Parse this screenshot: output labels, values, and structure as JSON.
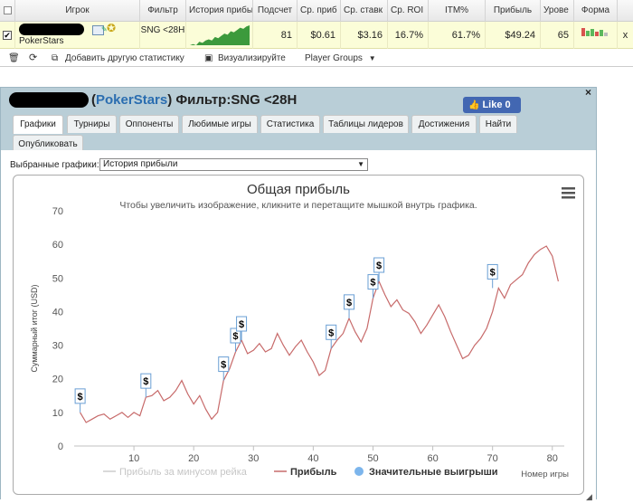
{
  "grid": {
    "headers": [
      "Игрок",
      "Фильтр",
      "История прибыли",
      "Подсчет",
      "Ср. приб",
      "Ср. ставк",
      "Ср. ROI",
      "ITM%",
      "Прибыль",
      "Урове",
      "Форма"
    ],
    "row": {
      "checked": true,
      "player": "PokerStars",
      "filter": "SNG <28H",
      "count": "81",
      "avg_profit": "$0.61",
      "avg_stake": "$3.16",
      "avg_roi": "16.7%",
      "itm": "61.7%",
      "profit": "$49.24",
      "level": "65",
      "remove": "x"
    },
    "sparkline": [
      2,
      3,
      2,
      5,
      4,
      6,
      7,
      6,
      9,
      8,
      10,
      12,
      11,
      14,
      13,
      15,
      17,
      16,
      18,
      19
    ],
    "form_bars": [
      {
        "h": 9,
        "color": "#d9534f"
      },
      {
        "h": 6,
        "color": "#5cb85c"
      },
      {
        "h": 8,
        "color": "#5cb85c"
      },
      {
        "h": 5,
        "color": "#d9534f"
      },
      {
        "h": 7,
        "color": "#5cb85c"
      },
      {
        "h": 4,
        "color": "#bbbbbb"
      }
    ]
  },
  "toolbar": {
    "add_stats": "Добавить другую статистику",
    "visualize": "Визуализируйте",
    "player_groups": "Player Groups"
  },
  "panel": {
    "title_open": "(",
    "site": "PokerStars",
    "title_close": ") Фильтр:SNG <28H",
    "fb_like": "Like 0",
    "close": "×",
    "tabs": [
      "Графики",
      "Турниры",
      "Оппоненты",
      "Любимые игры",
      "Статистика",
      "Таблицы лидеров",
      "Достижения",
      "Найти",
      "Опубликовать"
    ],
    "selected_label": "Выбранные графики:",
    "selected_value": "История прибыли"
  },
  "chart_data": {
    "type": "line",
    "title": "Общая прибыль",
    "subtitle": "Чтобы увеличить изображение, кликните и перетащите мышкой внутрь графика.",
    "xlabel": "Номер игры",
    "ylabel": "Суммарный итог (USD)",
    "xlim": [
      0,
      82
    ],
    "ylim": [
      0,
      70
    ],
    "xticks": [
      10,
      20,
      30,
      40,
      50,
      60,
      70,
      80
    ],
    "yticks": [
      0,
      10,
      20,
      30,
      40,
      50,
      60,
      70
    ],
    "series": [
      {
        "name": "Прибыль",
        "color": "#c76a6a",
        "x": [
          1,
          2,
          3,
          4,
          5,
          6,
          7,
          8,
          9,
          10,
          11,
          12,
          13,
          14,
          15,
          16,
          17,
          18,
          19,
          20,
          21,
          22,
          23,
          24,
          25,
          26,
          27,
          28,
          29,
          30,
          31,
          32,
          33,
          34,
          35,
          36,
          37,
          38,
          39,
          40,
          41,
          42,
          43,
          44,
          45,
          46,
          47,
          48,
          49,
          50,
          51,
          52,
          53,
          54,
          55,
          56,
          57,
          58,
          59,
          60,
          61,
          62,
          63,
          64,
          65,
          66,
          67,
          68,
          69,
          70,
          71,
          72,
          73,
          74,
          75,
          76,
          77,
          78,
          79,
          80,
          81
        ],
        "y": [
          10,
          7,
          8,
          9,
          9.5,
          8,
          9,
          10,
          8.5,
          10,
          9,
          14.5,
          15,
          16.5,
          13.5,
          14.5,
          16.5,
          19.5,
          15.5,
          12.5,
          15,
          11,
          8,
          10,
          19.5,
          23,
          28,
          31.5,
          27.5,
          28.5,
          30.5,
          28,
          29,
          33.5,
          30,
          27,
          29.5,
          31.5,
          28,
          25,
          21,
          22.5,
          29,
          31.5,
          33.5,
          38,
          34,
          31,
          35,
          44,
          49,
          45,
          41.5,
          43.5,
          40.5,
          39.5,
          37,
          33.5,
          36,
          39,
          42,
          38.5,
          34,
          30,
          26,
          27,
          30,
          32,
          35,
          40,
          47,
          44,
          48,
          49.5,
          51,
          54.5,
          57,
          58.5,
          59.5,
          56.5,
          49
        ]
      },
      {
        "name": "Прибыль за минусом рейка",
        "color": "#cccccc",
        "x": [],
        "y": []
      },
      {
        "name": "Значительные выигрыши",
        "color": "#7cb5ec",
        "x": [
          1,
          12,
          25,
          27,
          28,
          43,
          46,
          50,
          51,
          70
        ],
        "y": [
          10,
          14.5,
          19.5,
          28,
          31.5,
          29,
          38,
          44,
          49,
          47
        ]
      }
    ],
    "marker_label": "$"
  }
}
